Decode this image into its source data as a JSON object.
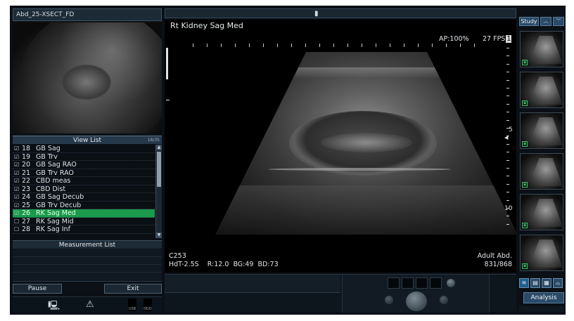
{
  "study": {
    "title": "Abd_25-XSECT_FD"
  },
  "view_list": {
    "header": "View List",
    "count": "18/35",
    "items": [
      {
        "checked": true,
        "num": "18",
        "label": "GB Sag",
        "selected": false
      },
      {
        "checked": true,
        "num": "19",
        "label": "GB Trv",
        "selected": false
      },
      {
        "checked": true,
        "num": "20",
        "label": "GB Sag RAO",
        "selected": false
      },
      {
        "checked": true,
        "num": "21",
        "label": "GB Trv RAO",
        "selected": false
      },
      {
        "checked": true,
        "num": "22",
        "label": "CBD meas",
        "selected": false
      },
      {
        "checked": true,
        "num": "23",
        "label": "CBD Dist",
        "selected": false
      },
      {
        "checked": true,
        "num": "24",
        "label": "GB Sag Decub",
        "selected": false
      },
      {
        "checked": true,
        "num": "25",
        "label": "GB Trv Decub",
        "selected": false
      },
      {
        "checked": true,
        "num": "26",
        "label": "RK Sag Med",
        "selected": true
      },
      {
        "checked": false,
        "num": "27",
        "label": "RK Sag Mid",
        "selected": false
      },
      {
        "checked": false,
        "num": "28",
        "label": "RK Sag Inf",
        "selected": false
      }
    ]
  },
  "measurement_list": {
    "header": "Measurement List"
  },
  "buttons": {
    "pause": "Pause",
    "exit": "Exit",
    "study": "Study",
    "analysis": "Analysis"
  },
  "image": {
    "title": "Rt Kidney Sag Med",
    "ap": "AP:100%",
    "fps_label": "27 FPS",
    "fps_value": "1",
    "depth_mark_1": "5",
    "depth_mark_2": "10",
    "probe": "C253",
    "params": "HdT-2.5S    R:12.0  BG:49  BD:73",
    "preset": "Adult Abd.",
    "frame": "831/868"
  },
  "status": {
    "ind_left": "USB",
    "ind_right": "HDD"
  },
  "thumbnails_count": 6,
  "colors": {
    "accent": "#2a4a68",
    "selected": "#1a9a4a",
    "background": "#0b1016"
  }
}
